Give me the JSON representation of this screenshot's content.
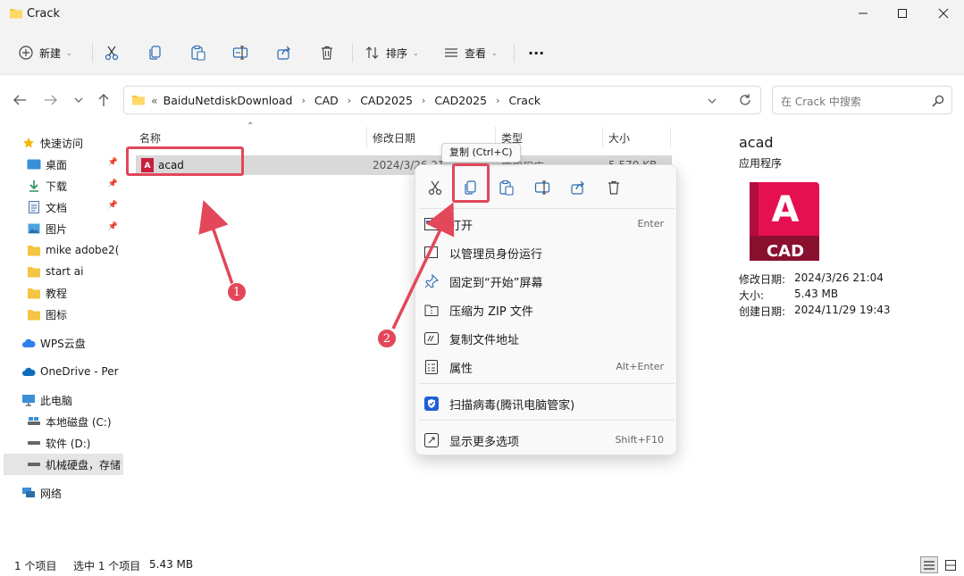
{
  "window": {
    "title": "Crack"
  },
  "toolbar": {
    "new_label": "新建",
    "sort_label": "排序",
    "view_label": "查看",
    "more_label": "···"
  },
  "address": {
    "prefix": "«",
    "crumbs": [
      "BaiduNetdiskDownload",
      "CAD",
      "CAD2025",
      "CAD2025",
      "Crack"
    ],
    "search_placeholder": "在 Crack 中搜索"
  },
  "sidebar": {
    "items": [
      {
        "label": "快速访问",
        "icon": "star-icon"
      },
      {
        "label": "桌面",
        "icon": "desktop-icon"
      },
      {
        "label": "下载",
        "icon": "download-icon"
      },
      {
        "label": "文档",
        "icon": "document-icon"
      },
      {
        "label": "图片",
        "icon": "picture-icon"
      },
      {
        "label": "mike adobe2(",
        "icon": "folder-icon"
      },
      {
        "label": "start ai",
        "icon": "folder-icon"
      },
      {
        "label": "教程",
        "icon": "folder-icon"
      },
      {
        "label": "图标",
        "icon": "folder-icon"
      },
      {
        "label": "WPS云盘",
        "icon": "cloud-icon"
      },
      {
        "label": "OneDrive - Per",
        "icon": "onedrive-icon"
      },
      {
        "label": "此电脑",
        "icon": "pc-icon"
      },
      {
        "label": "本地磁盘 (C:)",
        "icon": "drive-icon"
      },
      {
        "label": "软件 (D:)",
        "icon": "drive-icon"
      },
      {
        "label": "机械硬盘，存储",
        "icon": "drive-icon"
      },
      {
        "label": "网络",
        "icon": "network-icon"
      }
    ]
  },
  "files": {
    "columns": [
      "名称",
      "修改日期",
      "类型",
      "大小"
    ],
    "rows": [
      {
        "name": "acad",
        "modified": "2024/3/26 21",
        "type": "应用程序",
        "size": "5,570 KB"
      }
    ]
  },
  "details": {
    "name": "acad",
    "type": "应用程序",
    "app_icon_letter": "A",
    "app_icon_text": "CAD",
    "rows": [
      {
        "label": "修改日期:",
        "value": "2024/3/26 21:04"
      },
      {
        "label": "大小:",
        "value": "5.43 MB"
      },
      {
        "label": "创建日期:",
        "value": "2024/11/29 19:43"
      }
    ]
  },
  "tooltip": {
    "text": "复制 (Ctrl+C)"
  },
  "context_menu": {
    "items": [
      {
        "label": "打开",
        "shortcut": "Enter",
        "icon": "open-icon"
      },
      {
        "label": "以管理员身份运行",
        "shortcut": "",
        "icon": "admin-icon"
      },
      {
        "label": "固定到“开始”屏幕",
        "shortcut": "",
        "icon": "pin-icon"
      },
      {
        "label": "压缩为 ZIP 文件",
        "shortcut": "",
        "icon": "zip-icon"
      },
      {
        "label": "复制文件地址",
        "shortcut": "",
        "icon": "path-icon"
      },
      {
        "label": "属性",
        "shortcut": "Alt+Enter",
        "icon": "properties-icon"
      },
      {
        "label": "扫描病毒(腾讯电脑管家)",
        "shortcut": "",
        "icon": "shield-icon"
      },
      {
        "label": "显示更多选项",
        "shortcut": "Shift+F10",
        "icon": "more-options-icon"
      }
    ]
  },
  "annotations": {
    "step1": "1",
    "step2": "2",
    "color": "#e2475a"
  },
  "status": {
    "count": "1 个项目",
    "selected": "选中 1 个项目",
    "size": "5.43 MB"
  }
}
